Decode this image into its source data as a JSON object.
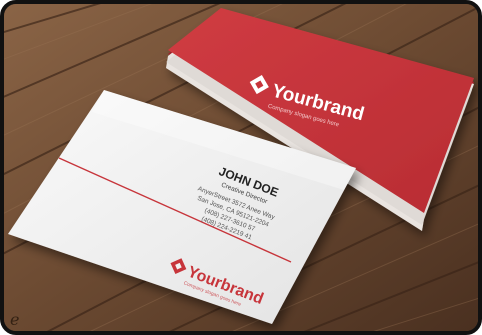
{
  "brand": {
    "name": "Yourbrand",
    "tagline": "Company slogan goes here",
    "logo_icon": "diamond-logo-icon"
  },
  "person": {
    "name": "JOHN DOE",
    "title": "Creative Director"
  },
  "contact": {
    "address_line_1": "AnyerStreet 3572 Anee Way",
    "address_line_2": "San Jose, CA 95121-2204",
    "phone_1": "(408) 227-3610 57",
    "phone_2": "(408) 224-2219 41"
  },
  "colors": {
    "brand_red": "#c7343a",
    "wood": "#6b4a33",
    "card_white": "#f2f2f2"
  },
  "scene_labels": {
    "corner_mark": "e"
  }
}
